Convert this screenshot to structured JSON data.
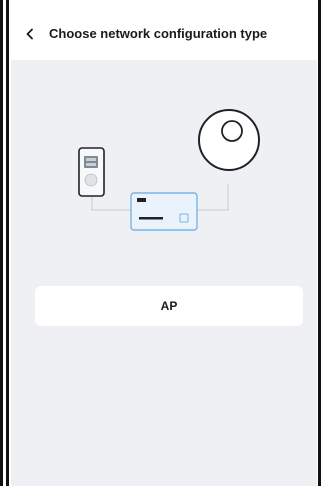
{
  "header": {
    "back_icon": "chevron-left-icon",
    "title": "Choose network configuration type"
  },
  "illustration": {
    "icons": [
      "phone-icon",
      "router-icon",
      "robot-vacuum-icon"
    ]
  },
  "options": [
    {
      "label": "AP"
    }
  ],
  "colors": {
    "background": "#eef0f3",
    "header_bg": "#ffffff",
    "card_bg": "#ffffff",
    "text": "#1a1a1a",
    "accent_blue": "#7ab4e8"
  }
}
